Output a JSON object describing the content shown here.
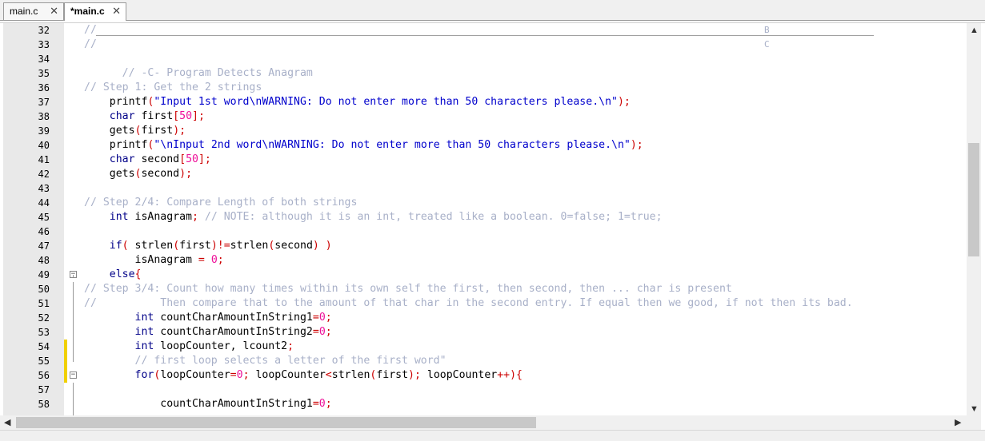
{
  "tabs": [
    {
      "label": "main.c",
      "close": "✕",
      "active": false
    },
    {
      "label": "*main.c",
      "close": "✕",
      "active": true
    }
  ],
  "editor": {
    "lines": [
      {
        "num": "32",
        "marker": false,
        "fold": "",
        "segments": [
          {
            "t": "//",
            "c": "cm"
          }
        ],
        "extra": "B"
      },
      {
        "num": "33",
        "marker": false,
        "fold": "",
        "segments": [
          {
            "t": "//",
            "c": "cm"
          }
        ],
        "extra": "C"
      },
      {
        "num": "34",
        "marker": false,
        "fold": "",
        "segments": []
      },
      {
        "num": "35",
        "marker": false,
        "fold": "",
        "segments": [
          {
            "t": "      // -C- Program Detects Anagram",
            "c": "cm"
          }
        ]
      },
      {
        "num": "36",
        "marker": false,
        "fold": "",
        "segments": [
          {
            "t": "// Step 1: Get the 2 strings",
            "c": "cm"
          }
        ]
      },
      {
        "num": "37",
        "marker": false,
        "fold": "",
        "segments": [
          {
            "t": "    printf",
            "c": "pl"
          },
          {
            "t": "(",
            "c": "op"
          },
          {
            "t": "\"Input 1st word\\nWARNING: Do not enter more than 50 characters please.\\n\"",
            "c": "st"
          },
          {
            "t": ");",
            "c": "op"
          }
        ]
      },
      {
        "num": "38",
        "marker": false,
        "fold": "",
        "segments": [
          {
            "t": "    ",
            "c": "pl"
          },
          {
            "t": "char",
            "c": "kw"
          },
          {
            "t": " first",
            "c": "pl"
          },
          {
            "t": "[",
            "c": "op"
          },
          {
            "t": "50",
            "c": "nm"
          },
          {
            "t": "];",
            "c": "op"
          }
        ]
      },
      {
        "num": "39",
        "marker": false,
        "fold": "",
        "segments": [
          {
            "t": "    gets",
            "c": "pl"
          },
          {
            "t": "(",
            "c": "op"
          },
          {
            "t": "first",
            "c": "pl"
          },
          {
            "t": ");",
            "c": "op"
          }
        ]
      },
      {
        "num": "40",
        "marker": false,
        "fold": "",
        "segments": [
          {
            "t": "    printf",
            "c": "pl"
          },
          {
            "t": "(",
            "c": "op"
          },
          {
            "t": "\"\\nInput 2nd word\\nWARNING: Do not enter more than 50 characters please.\\n\"",
            "c": "st"
          },
          {
            "t": ");",
            "c": "op"
          }
        ]
      },
      {
        "num": "41",
        "marker": false,
        "fold": "",
        "segments": [
          {
            "t": "    ",
            "c": "pl"
          },
          {
            "t": "char",
            "c": "kw"
          },
          {
            "t": " second",
            "c": "pl"
          },
          {
            "t": "[",
            "c": "op"
          },
          {
            "t": "50",
            "c": "nm"
          },
          {
            "t": "];",
            "c": "op"
          }
        ]
      },
      {
        "num": "42",
        "marker": false,
        "fold": "",
        "segments": [
          {
            "t": "    gets",
            "c": "pl"
          },
          {
            "t": "(",
            "c": "op"
          },
          {
            "t": "second",
            "c": "pl"
          },
          {
            "t": ");",
            "c": "op"
          }
        ]
      },
      {
        "num": "43",
        "marker": false,
        "fold": "",
        "segments": []
      },
      {
        "num": "44",
        "marker": false,
        "fold": "",
        "segments": [
          {
            "t": "// Step 2/4: Compare Length of both strings",
            "c": "cm"
          }
        ]
      },
      {
        "num": "45",
        "marker": false,
        "fold": "",
        "segments": [
          {
            "t": "    ",
            "c": "pl"
          },
          {
            "t": "int",
            "c": "kw"
          },
          {
            "t": " isAnagram",
            "c": "pl"
          },
          {
            "t": ";",
            "c": "op"
          },
          {
            "t": " // NOTE: although it is an int, treated like a boolean. 0=false; 1=true;",
            "c": "cm"
          }
        ]
      },
      {
        "num": "46",
        "marker": false,
        "fold": "",
        "segments": []
      },
      {
        "num": "47",
        "marker": false,
        "fold": "",
        "segments": [
          {
            "t": "    ",
            "c": "pl"
          },
          {
            "t": "if",
            "c": "kw"
          },
          {
            "t": "(",
            "c": "op"
          },
          {
            "t": " strlen",
            "c": "pl"
          },
          {
            "t": "(",
            "c": "op"
          },
          {
            "t": "first",
            "c": "pl"
          },
          {
            "t": ")!=",
            "c": "op"
          },
          {
            "t": "strlen",
            "c": "pl"
          },
          {
            "t": "(",
            "c": "op"
          },
          {
            "t": "second",
            "c": "pl"
          },
          {
            "t": ") )",
            "c": "op"
          }
        ]
      },
      {
        "num": "48",
        "marker": false,
        "fold": "",
        "segments": [
          {
            "t": "        isAnagram ",
            "c": "pl"
          },
          {
            "t": "=",
            "c": "op"
          },
          {
            "t": " ",
            "c": "pl"
          },
          {
            "t": "0",
            "c": "nm"
          },
          {
            "t": ";",
            "c": "op"
          }
        ]
      },
      {
        "num": "49",
        "marker": false,
        "fold": "−",
        "segments": [
          {
            "t": "    ",
            "c": "pl"
          },
          {
            "t": "else",
            "c": "kw"
          },
          {
            "t": "{",
            "c": "op"
          }
        ]
      },
      {
        "num": "50",
        "marker": false,
        "fold": "",
        "segments": [
          {
            "t": "// Step 3/4: Count how many times within its own self the first, then second, then ... char is present",
            "c": "cm"
          }
        ]
      },
      {
        "num": "51",
        "marker": false,
        "fold": "",
        "segments": [
          {
            "t": "//          Then compare that to the amount of that char in the second entry. If equal then we good, if not then its bad.",
            "c": "cm"
          }
        ]
      },
      {
        "num": "52",
        "marker": false,
        "fold": "",
        "segments": [
          {
            "t": "        ",
            "c": "pl"
          },
          {
            "t": "int",
            "c": "kw"
          },
          {
            "t": " countCharAmountInString1",
            "c": "pl"
          },
          {
            "t": "=",
            "c": "op"
          },
          {
            "t": "0",
            "c": "nm"
          },
          {
            "t": ";",
            "c": "op"
          }
        ]
      },
      {
        "num": "53",
        "marker": false,
        "fold": "",
        "segments": [
          {
            "t": "        ",
            "c": "pl"
          },
          {
            "t": "int",
            "c": "kw"
          },
          {
            "t": " countCharAmountInString2",
            "c": "pl"
          },
          {
            "t": "=",
            "c": "op"
          },
          {
            "t": "0",
            "c": "nm"
          },
          {
            "t": ";",
            "c": "op"
          }
        ]
      },
      {
        "num": "54",
        "marker": true,
        "fold": "",
        "segments": [
          {
            "t": "        ",
            "c": "pl"
          },
          {
            "t": "int",
            "c": "kw"
          },
          {
            "t": " loopCounter, lcount2",
            "c": "pl"
          },
          {
            "t": ";",
            "c": "op"
          }
        ]
      },
      {
        "num": "55",
        "marker": true,
        "fold": "",
        "segments": [
          {
            "t": "        // first loop selects a letter of the first word\"",
            "c": "cm"
          }
        ]
      },
      {
        "num": "56",
        "marker": true,
        "fold": "−",
        "segments": [
          {
            "t": "        ",
            "c": "pl"
          },
          {
            "t": "for",
            "c": "kw"
          },
          {
            "t": "(",
            "c": "op"
          },
          {
            "t": "loopCounter",
            "c": "pl"
          },
          {
            "t": "=",
            "c": "op"
          },
          {
            "t": "0",
            "c": "nm"
          },
          {
            "t": ";",
            "c": "op"
          },
          {
            "t": " loopCounter",
            "c": "pl"
          },
          {
            "t": "<",
            "c": "op"
          },
          {
            "t": "strlen",
            "c": "pl"
          },
          {
            "t": "(",
            "c": "op"
          },
          {
            "t": "first",
            "c": "pl"
          },
          {
            "t": ");",
            "c": "op"
          },
          {
            "t": " loopCounter",
            "c": "pl"
          },
          {
            "t": "++){",
            "c": "op"
          }
        ]
      },
      {
        "num": "57",
        "marker": false,
        "fold": "",
        "segments": []
      },
      {
        "num": "58",
        "marker": false,
        "fold": "",
        "segments": [
          {
            "t": "            countCharAmountInString1",
            "c": "pl"
          },
          {
            "t": "=",
            "c": "op"
          },
          {
            "t": "0",
            "c": "nm"
          },
          {
            "t": ";",
            "c": "op"
          }
        ]
      }
    ]
  },
  "scrollbars": {
    "up": "▲",
    "down": "▼",
    "left": "◀",
    "right": "▶"
  }
}
